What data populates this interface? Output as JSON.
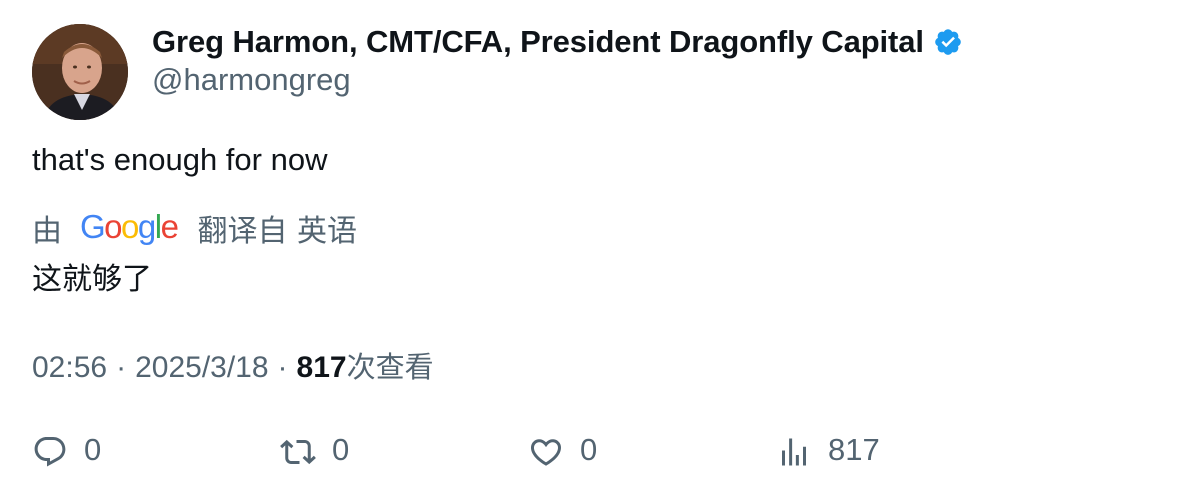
{
  "tweet": {
    "author": {
      "display_name": "Greg Harmon, CMT/CFA, President Dragonfly Capital",
      "handle": "@harmongreg",
      "verified": true,
      "verified_color": "#1d9bf0"
    },
    "text": "that's enough for now",
    "translation": {
      "by_label": "由",
      "provider": "Google",
      "from_label": "翻译自 英语",
      "text": "这就够了"
    },
    "meta": {
      "time": "02:56",
      "separator": "·",
      "date": "2025/3/18",
      "views_count": "817",
      "views_label": "次查看"
    },
    "actions": {
      "reply_icon": "reply-icon",
      "reply_count": "0",
      "retweet_icon": "retweet-icon",
      "retweet_count": "0",
      "like_icon": "heart-icon",
      "like_count": "0",
      "views_icon": "bar-chart-icon",
      "views_count": "817"
    }
  },
  "colors": {
    "text_primary": "#0f1419",
    "text_secondary": "#536471",
    "google_blue": "#4285F4",
    "google_red": "#EA4335",
    "google_yellow": "#FBBC05",
    "google_green": "#34A853"
  }
}
